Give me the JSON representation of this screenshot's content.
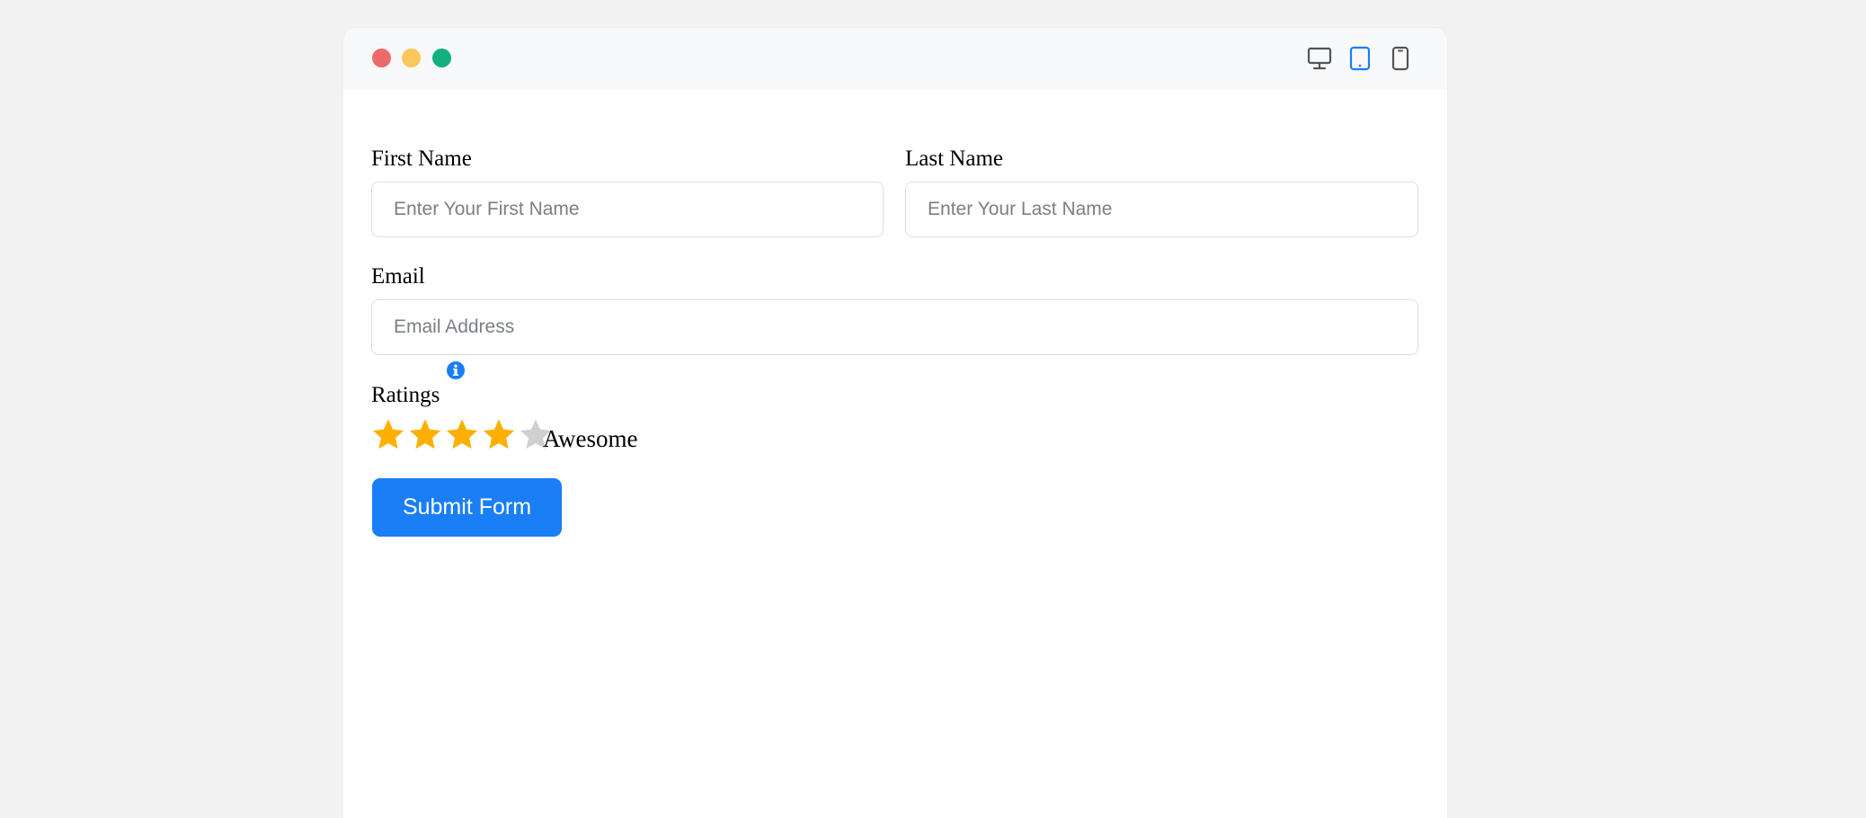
{
  "window": {
    "traffic_lights": {
      "close_color": "#ec6a6a",
      "minimize_color": "#fbc65a",
      "maximize_color": "#11b07c"
    },
    "device_toggles": [
      {
        "name": "desktop-icon",
        "active": false
      },
      {
        "name": "tablet-icon",
        "active": true
      },
      {
        "name": "mobile-icon",
        "active": false
      }
    ]
  },
  "form": {
    "first_name": {
      "label": "First Name",
      "placeholder": "Enter Your First Name",
      "value": ""
    },
    "last_name": {
      "label": "Last Name",
      "placeholder": "Enter Your Last Name",
      "value": ""
    },
    "email": {
      "label": "Email",
      "placeholder": "Email Address",
      "value": ""
    },
    "ratings": {
      "label": "Ratings",
      "info_icon": "info-circle-icon",
      "value": 4,
      "max": 5,
      "text": "Awesome",
      "filled_color": "#fdb000",
      "empty_color": "#d0d0d0"
    },
    "submit_label": "Submit Form"
  },
  "colors": {
    "accent": "#1a7ef7",
    "background": "#f2f2f2",
    "titlebar": "#f8f9fa"
  }
}
